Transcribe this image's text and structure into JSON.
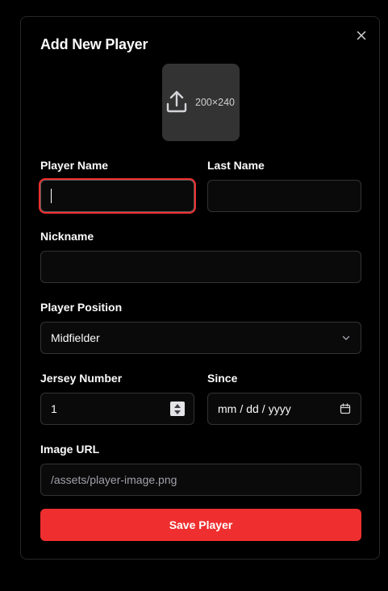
{
  "dialog": {
    "title": "Add New Player",
    "upload_dimensions": "200×240"
  },
  "form": {
    "player_name": {
      "label": "Player Name",
      "value": ""
    },
    "last_name": {
      "label": "Last Name",
      "value": ""
    },
    "nickname": {
      "label": "Nickname",
      "value": ""
    },
    "position": {
      "label": "Player Position",
      "selected": "Midfielder"
    },
    "jersey_number": {
      "label": "Jersey Number",
      "value": "1"
    },
    "since": {
      "label": "Since",
      "mm": "mm",
      "dd": "dd",
      "yyyy": "yyyy"
    },
    "image_url": {
      "label": "Image URL",
      "value": "/assets/player-image.png"
    }
  },
  "actions": {
    "save_label": "Save Player"
  },
  "colors": {
    "accent": "#ef2f2f",
    "background": "#000000",
    "border": "#333333"
  },
  "icons": [
    "close-icon",
    "upload-icon",
    "chevron-down-icon",
    "spinner-arrows-icon",
    "calendar-icon"
  ]
}
